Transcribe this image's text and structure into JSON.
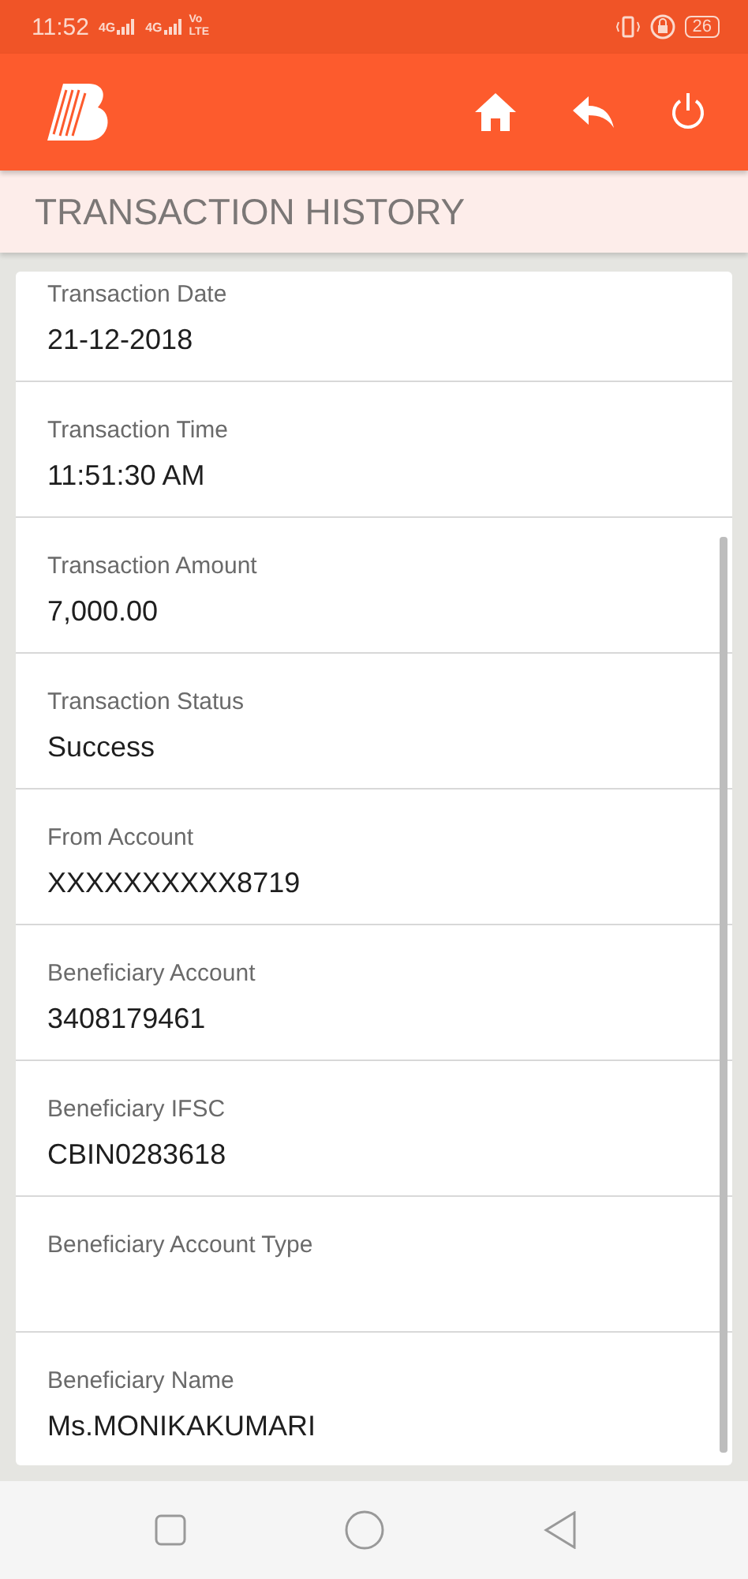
{
  "status_bar": {
    "time": "11:52",
    "networks": [
      "4G",
      "4G"
    ],
    "volte": "Vo LTE",
    "battery": "26"
  },
  "page_title": "TRANSACTION HISTORY",
  "details": [
    {
      "label": "Transaction Date",
      "value": "21-12-2018"
    },
    {
      "label": "Transaction Time",
      "value": "11:51:30 AM"
    },
    {
      "label": "Transaction Amount",
      "value": "7,000.00"
    },
    {
      "label": "Transaction Status",
      "value": "Success"
    },
    {
      "label": "From Account",
      "value": "XXXXXXXXXX8719"
    },
    {
      "label": "Beneficiary Account",
      "value": "3408179461"
    },
    {
      "label": "Beneficiary IFSC",
      "value": "CBIN0283618"
    },
    {
      "label": "Beneficiary Account Type"
    },
    {
      "label": "Beneficiary Name",
      "value": "Ms.MONIKAKUMARI"
    }
  ]
}
